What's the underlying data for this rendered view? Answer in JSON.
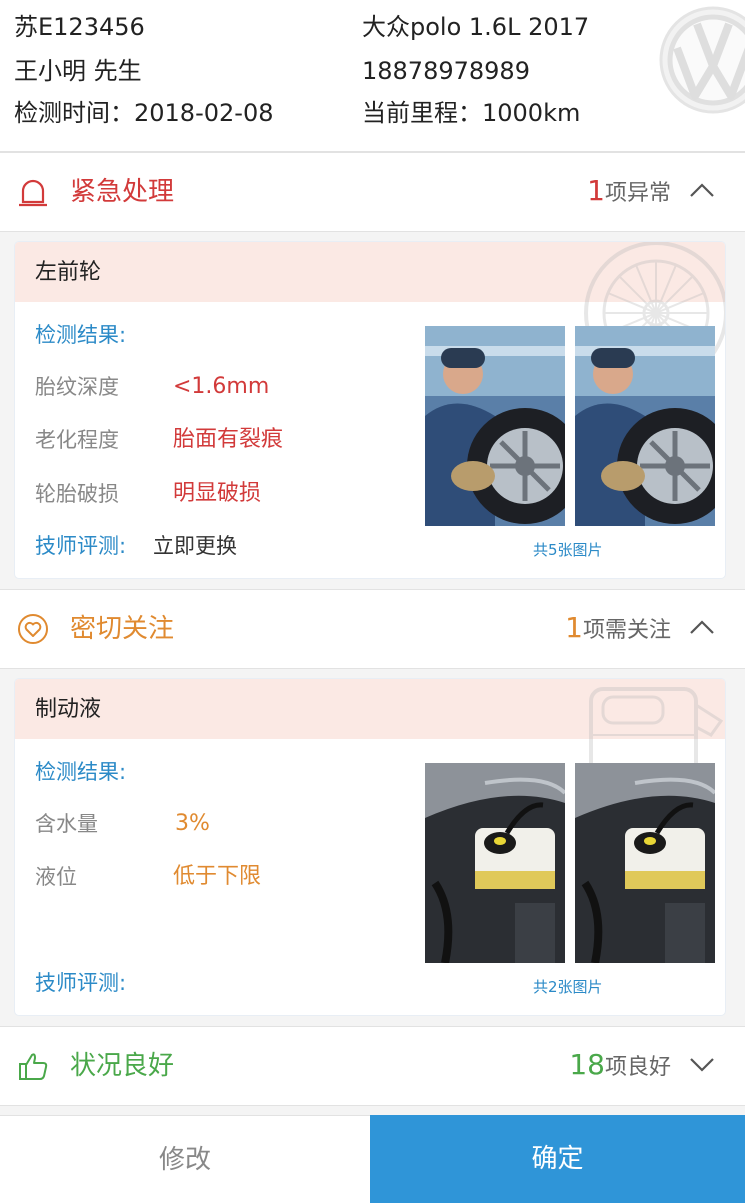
{
  "vehicle": {
    "plate": "苏E123456",
    "model": "大众polo  1.6L  2017",
    "owner": "王小明  先生",
    "phone": "18878978989",
    "inspection_date_label": "检测时间：",
    "inspection_date": "2018-02-08",
    "mileage_label": "当前里程：",
    "mileage": "1000km",
    "brand_logo": "volkswagen-logo"
  },
  "sections": {
    "urgent": {
      "title": "紧急处理",
      "count": "1",
      "count_text": "项异常",
      "icon": "alarm-bell-icon",
      "color": "#d23a3a",
      "expanded": true
    },
    "attention": {
      "title": "密切关注",
      "count": "1",
      "count_text": "项需关注",
      "icon": "heart-circle-icon",
      "color": "#e08a30",
      "expanded": true
    },
    "good": {
      "title": "状况良好",
      "count": "18",
      "count_text": "项良好",
      "icon": "thumbs-up-icon",
      "color": "#4aa84a",
      "expanded": false
    }
  },
  "urgent_item": {
    "name": "左前轮",
    "result_label": "检测结果:",
    "rows": [
      {
        "label": "胎纹深度",
        "value": "<1.6mm"
      },
      {
        "label": "老化程度",
        "value": "胎面有裂痕"
      },
      {
        "label": "轮胎破损",
        "value": "明显破损"
      }
    ],
    "tech_label": "技师评测:",
    "tech_value": "立即更换",
    "photo_count_text": "共5张图片"
  },
  "attention_item": {
    "name": "制动液",
    "result_label": "检测结果:",
    "rows": [
      {
        "label": "含水量",
        "value": "3%"
      },
      {
        "label": "液位",
        "value": "低于下限"
      }
    ],
    "tech_label": "技师评测:",
    "tech_value": "",
    "photo_count_text": "共2张图片"
  },
  "footer": {
    "edit_label": "修改",
    "confirm_label": "确定"
  },
  "colors": {
    "accent_blue": "#2f95d8",
    "card_header_bg": "#fbe9e4"
  }
}
